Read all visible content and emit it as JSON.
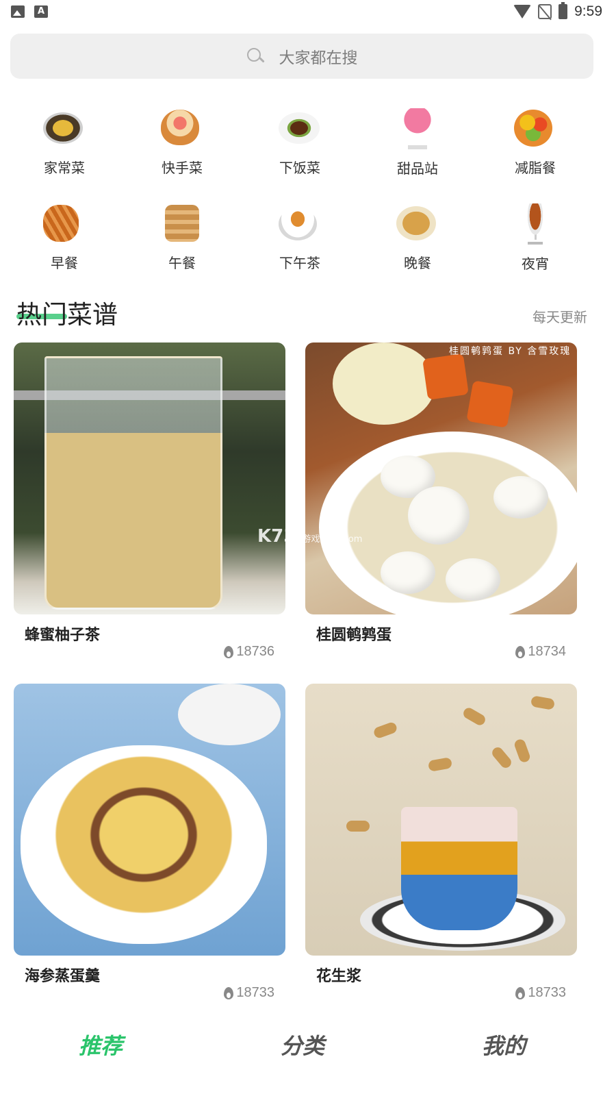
{
  "status_bar": {
    "time": "9:59"
  },
  "search": {
    "placeholder": "大家都在搜"
  },
  "categories": [
    {
      "label": "家常菜",
      "icon": "home-dish-icon"
    },
    {
      "label": "快手菜",
      "icon": "quick-dish-icon"
    },
    {
      "label": "下饭菜",
      "icon": "rice-dish-icon"
    },
    {
      "label": "甜品站",
      "icon": "dessert-icon"
    },
    {
      "label": "减脂餐",
      "icon": "diet-meal-icon"
    },
    {
      "label": "早餐",
      "icon": "breakfast-icon"
    },
    {
      "label": "午餐",
      "icon": "lunch-icon"
    },
    {
      "label": "下午茶",
      "icon": "afternoon-tea-icon"
    },
    {
      "label": "晚餐",
      "icon": "dinner-icon"
    },
    {
      "label": "夜宵",
      "icon": "late-snack-icon"
    }
  ],
  "section": {
    "title": "热门菜谱",
    "more": "每天更新",
    "accent": "#3cc878"
  },
  "recipes": [
    {
      "name": "蜂蜜柚子茶",
      "hot": "18736"
    },
    {
      "name": "桂圆鹌鹑蛋",
      "hot": "18734",
      "image_caption": "桂圆鹌鹑蛋  BY 含雪玫瑰",
      "watermark": "K73",
      "watermark_sub": "游戏之家 .com"
    },
    {
      "name": "海参蒸蛋羹",
      "hot": "18733"
    },
    {
      "name": "花生浆",
      "hot": "18733"
    }
  ],
  "bottom_nav": {
    "items": [
      "推荐",
      "分类",
      "我的"
    ],
    "active_index": 0,
    "active_color": "#2bc46b"
  }
}
